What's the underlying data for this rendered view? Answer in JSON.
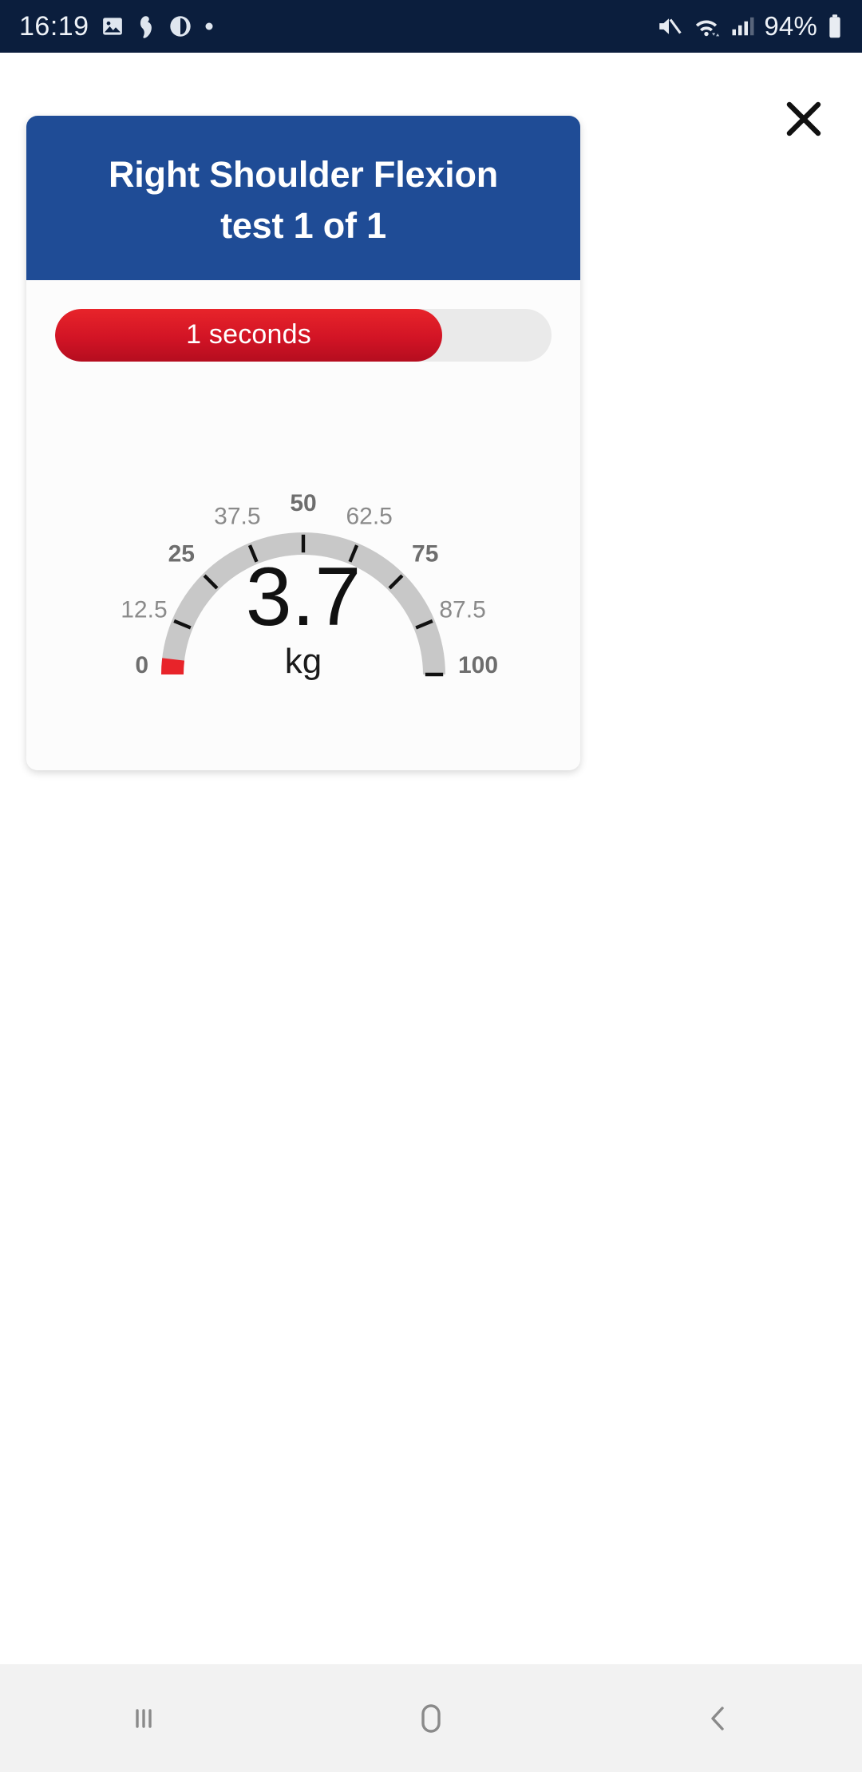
{
  "status_bar": {
    "clock": "16:19",
    "battery_text": "94%",
    "icons": [
      "image-icon",
      "pregnancy-app-icon",
      "moon-phase-icon",
      "dot-icon"
    ],
    "right_icons": [
      "mute-icon",
      "wifi-icon",
      "signal-icon",
      "battery-icon"
    ],
    "background_color": "#0b1e3d"
  },
  "close_button": {
    "icon": "close-icon",
    "label": "✕"
  },
  "card": {
    "header": {
      "title_line1": "Right Shoulder Flexion",
      "title_line2": "test 1 of 1",
      "background_color": "#1f4c96"
    },
    "progress": {
      "label": "1 seconds",
      "fill_percent": 78,
      "fill_color": "#d21425",
      "track_color": "#eaeaea"
    }
  },
  "chart_data": {
    "type": "gauge",
    "title": "",
    "value": 3.7,
    "value_text": "3.7",
    "unit": "kg",
    "min": 0,
    "max": 100,
    "arc_color": "#c8c8c8",
    "value_color": "#e8242a",
    "ticks": [
      {
        "value": 0,
        "label": "0",
        "major": true
      },
      {
        "value": 12.5,
        "label": "12.5",
        "major": false
      },
      {
        "value": 25,
        "label": "25",
        "major": true
      },
      {
        "value": 37.5,
        "label": "37.5",
        "major": false
      },
      {
        "value": 50,
        "label": "50",
        "major": true
      },
      {
        "value": 62.5,
        "label": "62.5",
        "major": false
      },
      {
        "value": 75,
        "label": "75",
        "major": true
      },
      {
        "value": 87.5,
        "label": "87.5",
        "major": false
      },
      {
        "value": 100,
        "label": "100",
        "major": true
      }
    ]
  },
  "navbar": {
    "recents_icon": "recents-icon",
    "home_icon": "home-icon",
    "back_icon": "back-icon"
  }
}
